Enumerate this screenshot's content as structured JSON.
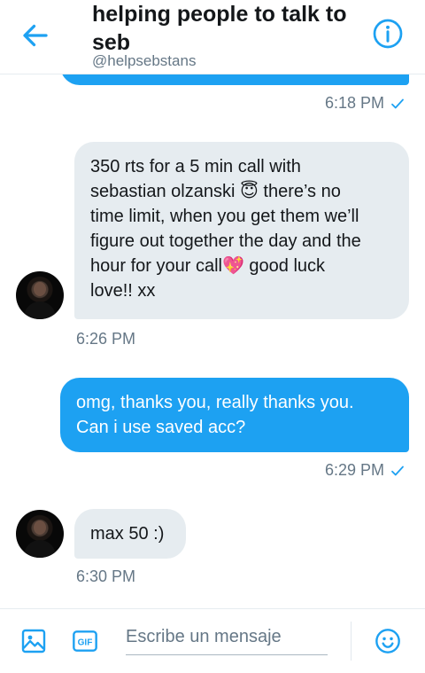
{
  "header": {
    "title": "helping people to talk to seb",
    "handle": "@helpsebstans"
  },
  "messages": [
    {
      "direction": "out",
      "text": "",
      "time": "6:18 PM",
      "read": true
    },
    {
      "direction": "in",
      "text": "350 rts for a 5 min call with\nsebastian olzanski 😇 there’s no\ntime limit, when you get them we’ll\nfigure out together the day and the\nhour for your call💖 good luck\nlove!! xx",
      "time": "6:26 PM"
    },
    {
      "direction": "out",
      "text": "omg, thanks you, really thanks you.\nCan i use saved acc?",
      "time": "6:29 PM",
      "read": true
    },
    {
      "direction": "in",
      "text": "max 50 :)",
      "time": "6:30 PM"
    }
  ],
  "composer": {
    "placeholder": "Escribe un mensaje",
    "gif_label": "GIF"
  },
  "colors": {
    "accent": "#1da1f2",
    "incoming_bubble": "#e6ecf0",
    "muted_text": "#657786"
  },
  "icons": [
    "back-arrow-icon",
    "info-icon",
    "image-icon",
    "gif-icon",
    "emoji-icon",
    "read-check-icon"
  ]
}
